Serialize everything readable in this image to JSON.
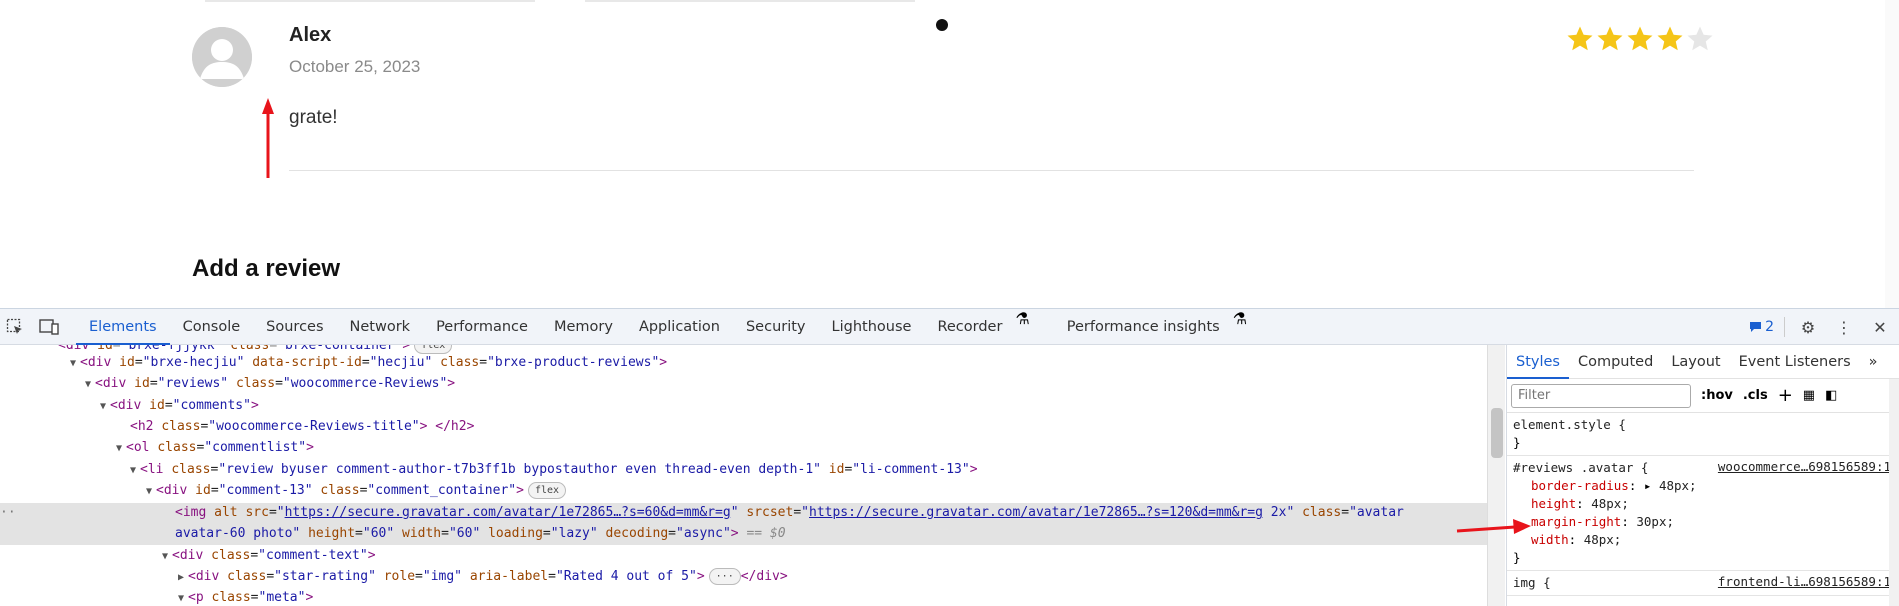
{
  "review": {
    "author": "Alex",
    "date": "October 25, 2023",
    "text": "grate!",
    "rating_value": 4,
    "rating_max": 5,
    "star_color": "#f5c518",
    "star_empty_color": "#e6e6e6"
  },
  "add_review_heading": "Add a review",
  "colors": {
    "annotation_red": "#e8141b",
    "devtools_blue": "#1a5fd0"
  },
  "devtools": {
    "tabs": [
      "Elements",
      "Console",
      "Sources",
      "Network",
      "Performance",
      "Memory",
      "Application",
      "Security",
      "Lighthouse",
      "Recorder",
      "Performance insights"
    ],
    "active_tab": "Elements",
    "issues_count": "2",
    "dom": {
      "l0_pill": "flex",
      "l1": {
        "tag": "div",
        "id": "brxe-hecjiu",
        "data_script_id": "hecjiu",
        "class": "brxe-product-reviews"
      },
      "l2": {
        "tag": "div",
        "id": "reviews",
        "class": "woocommerce-Reviews"
      },
      "l3": {
        "tag": "div",
        "id": "comments"
      },
      "l4": {
        "tag": "h2",
        "class": "woocommerce-Reviews-title"
      },
      "l5": {
        "tag": "ol",
        "class": "commentlist"
      },
      "l6": {
        "tag": "li",
        "class": "review byuser comment-author-t7b3ff1b bypostauthor even thread-even depth-1",
        "id": "li-comment-13"
      },
      "l7": {
        "tag": "div",
        "id": "comment-13",
        "class": "comment_container",
        "pill": "flex"
      },
      "l8": {
        "tag": "img",
        "src": "https://secure.gravatar.com/avatar/1e72865…?s=60&d=mm&r=g",
        "srcset": "https://secure.gravatar.com/avatar/1e72865…?s=120&d=mm&r=g",
        "srcset_suffix": "2x",
        "class_start": "avatar",
        "class_end": "avatar-60 photo",
        "height": "60",
        "width": "60",
        "loading": "lazy",
        "decoding": "async",
        "eq": "== $0"
      },
      "l9": {
        "tag": "div",
        "class": "comment-text"
      },
      "l10": {
        "tag": "div",
        "class": "star-rating",
        "role": "img",
        "aria_label": "Rated 4 out of 5"
      },
      "l11": {
        "tag": "p",
        "class": "meta"
      }
    },
    "styles": {
      "tabs": [
        "Styles",
        "Computed",
        "Layout",
        "Event Listeners"
      ],
      "active_tab": "Styles",
      "filter_placeholder": "Filter",
      "hov": ":hov",
      "cls": ".cls",
      "element_style": "element.style {",
      "rule1": {
        "selector": "#reviews .avatar {",
        "source": "woocommerce…698156589:1",
        "props": [
          {
            "name": "border-radius",
            "value": "48px;"
          },
          {
            "name": "height",
            "value": "48px;"
          },
          {
            "name": "margin-right",
            "value": "30px;"
          },
          {
            "name": "width",
            "value": "48px;"
          }
        ]
      },
      "rule2": {
        "selector": "img {",
        "source": "frontend-li…698156589:1"
      }
    }
  }
}
